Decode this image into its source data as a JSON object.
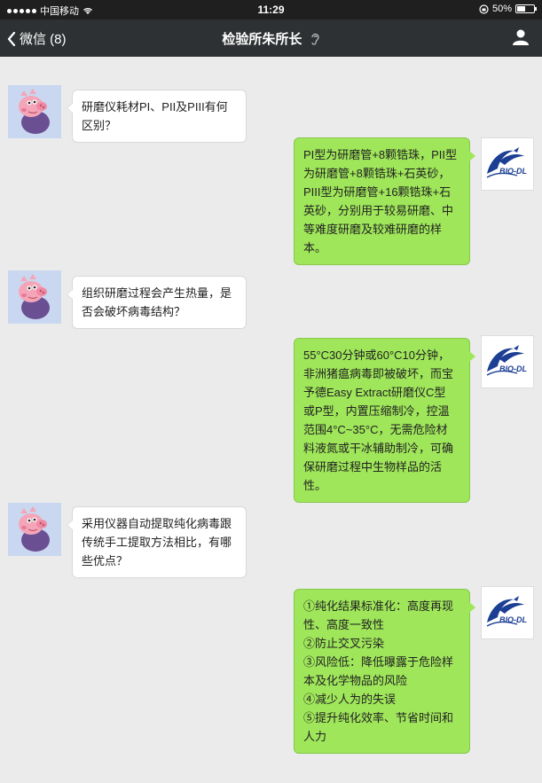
{
  "status_bar": {
    "carrier": "中国移动",
    "time": "11:29",
    "battery": "50%",
    "battery_level": 0.5
  },
  "nav": {
    "back_label": "微信 (8)",
    "title": "检验所朱所长"
  },
  "icons": {
    "back": "chevron-left-icon",
    "wifi": "wifi-icon",
    "mute": "ear-mute-icon",
    "user": "user-icon",
    "pig_avatar": "pig-avatar",
    "logo_avatar": "bio-dl-logo"
  },
  "colors": {
    "accent_bubble": "#9fe65a",
    "nav_background": "#2e3133",
    "chat_background": "#ebebeb"
  },
  "logo": {
    "text": "BIO-DL"
  },
  "messages": [
    {
      "side": "left",
      "text": "研磨仪耗材PI、PII及PIII有何\n区别？"
    },
    {
      "side": "right",
      "text": "PI型为研磨管+8颗锆珠，PII型\n为研磨管+8颗锆珠+石英砂，\nPIII型为研磨管+16颗锆珠+石\n英砂，分别用于较易研磨、中\n等难度研磨及较难研磨的样\n本。"
    },
    {
      "side": "left",
      "text": "组织研磨过程会产生热量，是\n否会破坏病毒结构？"
    },
    {
      "side": "right",
      "text": "55°C30分钟或60°C10分钟，\n非洲猪瘟病毒即被破坏，而宝\n予德Easy Extract研磨仪C型\n或P型，内置压缩制冷，控温\n范围4°C~35°C，无需危险材\n料液氮或干冰辅助制冷，可确\n保研磨过程中生物样品的活\n性。"
    },
    {
      "side": "left",
      "text": "采用仪器自动提取纯化病毒跟\n传统手工提取方法相比，有哪\n些优点？"
    },
    {
      "side": "right",
      "text": "①纯化结果标准化：高度再现\n性、高度一致性\n②防止交叉污染\n③风险低：降低曝露于危险样\n本及化学物品的风险\n④减少人为的失误\n⑤提升纯化效率、节省时间和\n人力"
    }
  ]
}
